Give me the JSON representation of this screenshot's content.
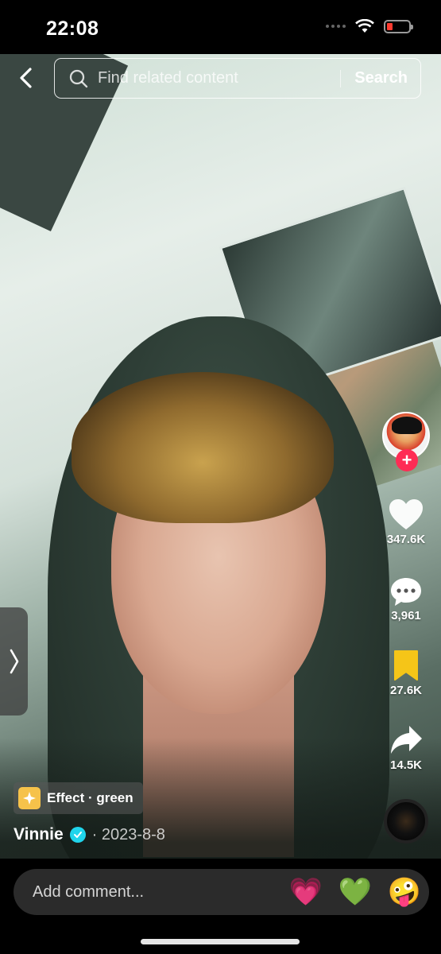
{
  "status_bar": {
    "time": "22:08"
  },
  "search": {
    "placeholder": "Find related content",
    "button_label": "Search"
  },
  "actions": {
    "likes": "347.6K",
    "comments": "3,961",
    "saves": "27.6K",
    "shares": "14.5K"
  },
  "effect": {
    "label": "Effect · green"
  },
  "author": {
    "name": "Vinnie",
    "date": "· 2023-8-8"
  },
  "comment_bar": {
    "placeholder": "Add comment...",
    "emojis": [
      "💗",
      "💚",
      "🤪"
    ]
  },
  "colors": {
    "follow_accent": "#fe2c55",
    "save_active": "#f5c518",
    "verified": "#20d5ec"
  }
}
